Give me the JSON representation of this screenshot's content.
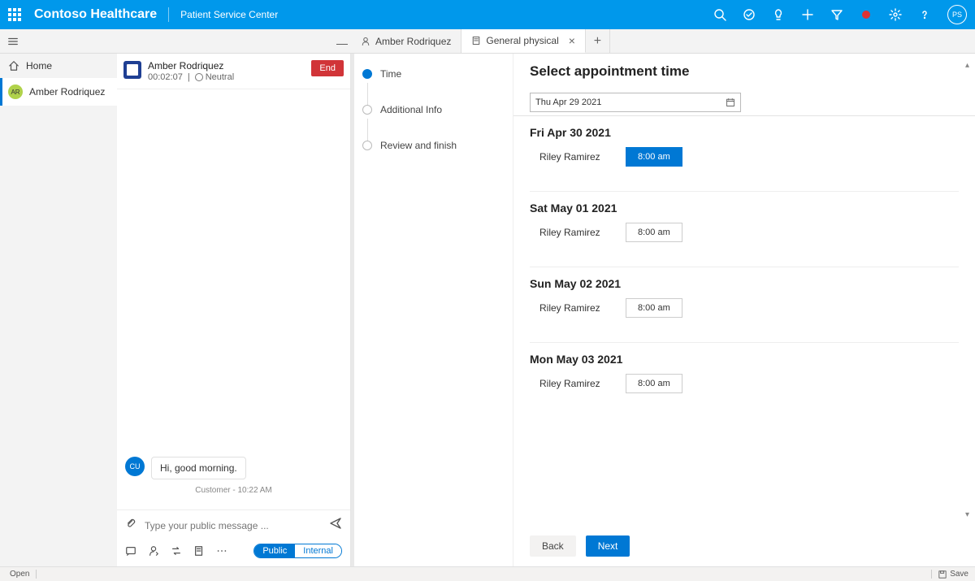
{
  "topbar": {
    "brand": "Contoso Healthcare",
    "subtitle": "Patient Service Center",
    "avatar_initials": "PS"
  },
  "leftrail": {
    "home": "Home",
    "active": {
      "initials": "AR",
      "name": "Amber Rodriquez"
    }
  },
  "tabs": {
    "tab1": "Amber Rodriquez",
    "tab2": "General physical"
  },
  "session": {
    "name": "Amber Rodriquez",
    "timer": "00:02:07",
    "sentiment": "Neutral",
    "end": "End"
  },
  "chat": {
    "avatar": "CU",
    "message": "Hi, good morning.",
    "meta": "Customer - 10:22 AM",
    "placeholder": "Type your public message ...",
    "pill_public": "Public",
    "pill_internal": "Internal"
  },
  "steps": {
    "s1": "Time",
    "s2": "Additional Info",
    "s3": "Review and finish"
  },
  "detail": {
    "title": "Select appointment time",
    "date_value": "Thu Apr 29 2021",
    "days": [
      {
        "head": "Fri Apr 30 2021",
        "provider": "Riley Ramirez",
        "slot": "8:00 am",
        "selected": true
      },
      {
        "head": "Sat May 01 2021",
        "provider": "Riley Ramirez",
        "slot": "8:00 am",
        "selected": false
      },
      {
        "head": "Sun May 02 2021",
        "provider": "Riley Ramirez",
        "slot": "8:00 am",
        "selected": false
      },
      {
        "head": "Mon May 03 2021",
        "provider": "Riley Ramirez",
        "slot": "8:00 am",
        "selected": false
      }
    ],
    "back": "Back",
    "next": "Next"
  },
  "statusbar": {
    "open": "Open",
    "save": "Save"
  }
}
